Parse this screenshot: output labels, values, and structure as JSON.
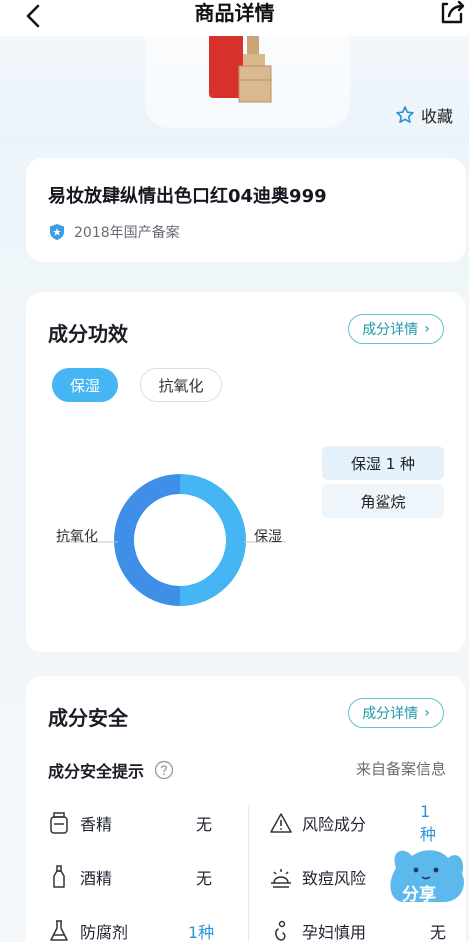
{
  "nav": {
    "title": "商品详情",
    "back_icon": "back-arrow-icon",
    "share_icon": "share-icon"
  },
  "hero": {
    "favorite_label": "收藏"
  },
  "product": {
    "name": "易妆放肆纵情出色口红04迪奥999",
    "record": "2018年国产备案"
  },
  "effect": {
    "title": "成分功效",
    "detail_label": "成分详情",
    "chevron": "›",
    "tabs": [
      {
        "label": "保湿",
        "active": true
      },
      {
        "label": "抗氧化",
        "active": false
      }
    ],
    "legend": [
      "保湿 1 种",
      "角鲨烷"
    ],
    "chart_labels": {
      "left": "抗氧化",
      "right": "保湿"
    }
  },
  "chart_data": {
    "type": "pie",
    "categories": [
      "保湿",
      "抗氧化"
    ],
    "values": [
      50,
      50
    ],
    "colors": [
      "#45b5f3",
      "#3f8ee8"
    ]
  },
  "safety": {
    "title": "成分安全",
    "detail_label": "成分详情",
    "chevron": "›",
    "subtitle": "成分安全提示",
    "source": "来自备案信息",
    "left_items": [
      {
        "name": "香精",
        "value": "无"
      },
      {
        "name": "酒精",
        "value": "无"
      },
      {
        "name": "防腐剂",
        "value": "1种"
      }
    ],
    "right_items": [
      {
        "name": "风险成分",
        "value": "1种"
      },
      {
        "name": "致痘风险",
        "value": ""
      },
      {
        "name": "孕妇慎用",
        "value": "无"
      }
    ]
  },
  "float_share": {
    "label": "分享"
  },
  "colors": {
    "accent": "#45b5f3",
    "teal": "#1a9aaa",
    "value_blue": "#2a95d8"
  }
}
